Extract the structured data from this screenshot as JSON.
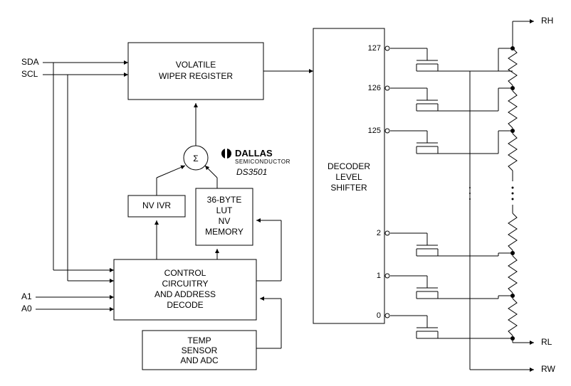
{
  "blocks": {
    "wiper": {
      "l1": "VOLATILE",
      "l2": "WIPER REGISTER"
    },
    "nvivr": {
      "l1": "NV IVR"
    },
    "lut": {
      "l1": "36-BYTE",
      "l2": "LUT",
      "l3": "NV",
      "l4": "MEMORY"
    },
    "ctrl": {
      "l1": "CONTROL",
      "l2": "CIRCUITRY",
      "l3": "AND ADDRESS",
      "l4": "DECODE"
    },
    "temp": {
      "l1": "TEMP",
      "l2": "SENSOR",
      "l3": "AND ADC"
    },
    "dec": {
      "l1": "DECODER",
      "l2": "LEVEL",
      "l3": "SHIFTER"
    },
    "sigma": "Σ"
  },
  "brand": {
    "name": "DALLAS",
    "sub": "SEMICONDUCTOR",
    "part": "DS3501"
  },
  "pins": {
    "sda": "SDA",
    "scl": "SCL",
    "a1": "A1",
    "a0": "A0",
    "rh": "RH",
    "rl": "RL",
    "rw": "RW"
  },
  "taps": {
    "t127": "127",
    "t126": "126",
    "t125": "125",
    "t2": "2",
    "t1": "1",
    "t0": "0"
  }
}
